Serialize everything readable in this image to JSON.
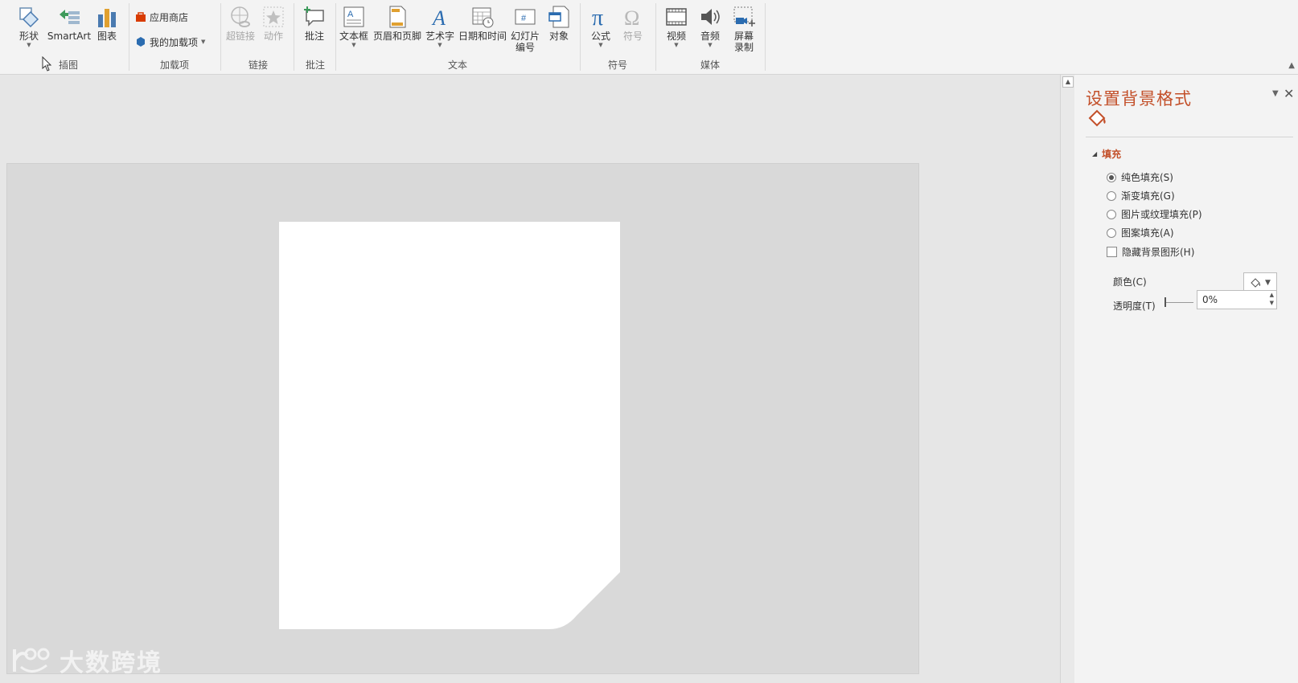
{
  "ribbon": {
    "groups": {
      "illustrations": "插图",
      "addins": "加载项",
      "links": "链接",
      "comments": "批注",
      "text": "文本",
      "symbols": "符号",
      "media": "媒体"
    },
    "buttons": {
      "shapes": "形状",
      "smartart": "SmartArt",
      "chart": "图表",
      "store": "应用商店",
      "my_addins": "我的加载项",
      "hyperlink": "超链接",
      "action": "动作",
      "comment": "批注",
      "textbox": "文本框",
      "header_footer": "页眉和页脚",
      "wordart": "艺术字",
      "datetime": "日期和时间",
      "slide_number_1": "幻灯片",
      "slide_number_2": "编号",
      "object": "对象",
      "equation": "公式",
      "symbol": "符号",
      "video": "视频",
      "audio": "音频",
      "screen_rec_1": "屏幕",
      "screen_rec_2": "录制"
    }
  },
  "pane": {
    "title": "设置背景格式",
    "section": "填充",
    "options": {
      "solid": "纯色填充(S)",
      "gradient": "渐变填充(G)",
      "picture": "图片或纹理填充(P)",
      "pattern": "图案填充(A)",
      "hide_bg": "隐藏背景图形(H)"
    },
    "selected_option": "solid",
    "color_label": "颜色(C)",
    "transparency_label": "透明度(T)",
    "transparency_value": "0%"
  },
  "watermark": "大数跨境",
  "colors": {
    "accent": "#c3502a",
    "slide_bg": "#d9d9d9",
    "page": "#ffffff"
  }
}
